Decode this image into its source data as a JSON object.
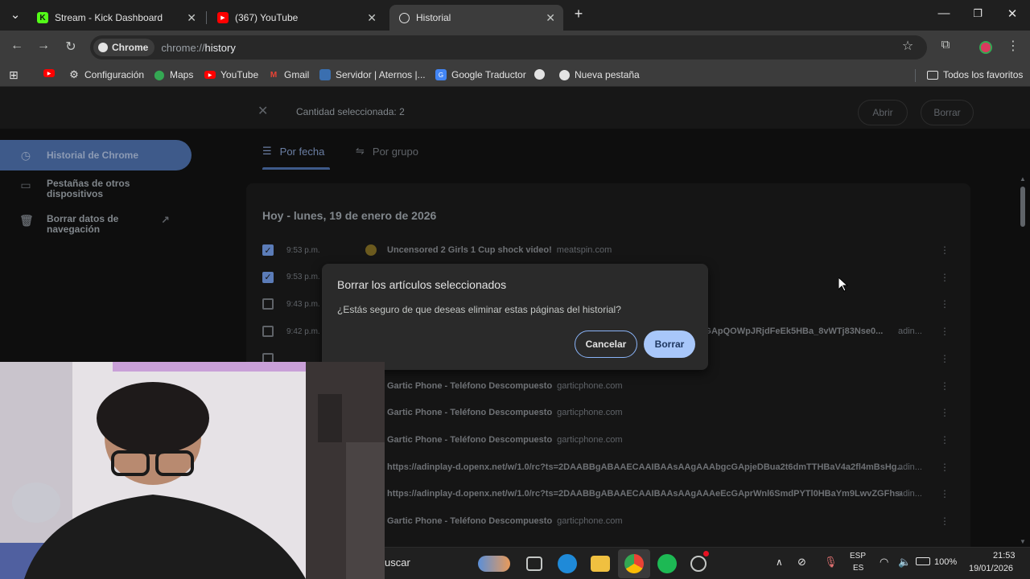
{
  "tabs": [
    {
      "label": "Stream - Kick Dashboard",
      "favicon": "kick-icon",
      "color": "#53fc18"
    },
    {
      "label": "(367) YouTube",
      "favicon": "youtube-icon",
      "color": "#ff0000"
    },
    {
      "label": "Historial",
      "favicon": "history-icon",
      "active": true
    }
  ],
  "toolbar": {
    "chip_label": "Chrome",
    "url_scheme": "chrome://",
    "url_path": "history"
  },
  "bookmarks": [
    {
      "label": "",
      "icon": "youtube-icon"
    },
    {
      "label": "Configuración",
      "icon": "gear-icon"
    },
    {
      "label": "Maps",
      "icon": "maps-icon"
    },
    {
      "label": "YouTube",
      "icon": "youtube-icon"
    },
    {
      "label": "Gmail",
      "icon": "gmail-icon"
    },
    {
      "label": "Servidor | Aternos |...",
      "icon": "aternos-icon"
    },
    {
      "label": "Google Traductor",
      "icon": "translate-icon"
    },
    {
      "label": "",
      "icon": "globe-icon"
    },
    {
      "label": "Nueva pestaña",
      "icon": "globe-icon"
    }
  ],
  "all_bookmarks_label": "Todos los favoritos",
  "selection": {
    "count_label": "Cantidad seleccionada: 2",
    "open_label": "Abrir",
    "delete_label": "Borrar"
  },
  "sidebar": {
    "items": [
      {
        "label": "Historial de Chrome",
        "icon": "history-icon",
        "active": true
      },
      {
        "label": "Pestañas de otros dispositivos",
        "icon": "devices-icon"
      },
      {
        "label": "Borrar datos de navegación",
        "icon": "trash-icon"
      }
    ]
  },
  "history_tabs": [
    {
      "label": "Por fecha",
      "icon": "list-icon",
      "active": true
    },
    {
      "label": "Por grupo",
      "icon": "group-icon"
    }
  ],
  "history": {
    "day_heading": "Hoy - lunes, 19 de enero de 2026",
    "rows": [
      {
        "time": "9:53 p.m.",
        "title": "Uncensored 2 Girls 1 Cup shock video!",
        "domain": "meatspin.com",
        "checked": true,
        "end": ""
      },
      {
        "time": "9:53 p.m.",
        "title": "",
        "domain": "",
        "checked": true,
        "end": ""
      },
      {
        "time": "9:43 p.m.",
        "title": "",
        "domain": "",
        "checked": false,
        "end": ""
      },
      {
        "time": "9:42 p.m.",
        "title": "...ccGApQOWpJRjdFeEk5HBa_8vWTj83Nse0...",
        "domain": "",
        "checked": false,
        "end": "adin..."
      },
      {
        "time": "",
        "title": "",
        "domain": "",
        "checked": false,
        "end": ""
      },
      {
        "time": "",
        "title": "Gartic Phone - Teléfono Descompuesto",
        "domain": "garticphone.com",
        "checked": false,
        "end": ""
      },
      {
        "time": "",
        "title": "Gartic Phone - Teléfono Descompuesto",
        "domain": "garticphone.com",
        "checked": false,
        "end": ""
      },
      {
        "time": "",
        "title": "Gartic Phone - Teléfono Descompuesto",
        "domain": "garticphone.com",
        "checked": false,
        "end": ""
      },
      {
        "time": "",
        "title": "https://adinplay-d.openx.net/w/1.0/rc?ts=2DAABBgABAAECAAIBAAsAAgAAAbgcGApjeDBua2t6dmTTHBaV4a2fl4mBsHg...",
        "domain": "",
        "checked": false,
        "end": "adin..."
      },
      {
        "time": "",
        "title": "https://adinplay-d.openx.net/w/1.0/rc?ts=2DAABBgABAAECAAIBAAsAAgAAAeEcGAprWnl6SmdPYTl0HBaYm9LwvZGFhs4...",
        "domain": "",
        "checked": false,
        "end": "adin..."
      },
      {
        "time": "",
        "title": "Gartic Phone - Teléfono Descompuesto",
        "domain": "garticphone.com",
        "checked": false,
        "end": ""
      }
    ]
  },
  "dialog": {
    "title": "Borrar los artículos seleccionados",
    "body": "¿Estás seguro de que deseas eliminar estas páginas del historial?",
    "cancel_label": "Cancelar",
    "confirm_label": "Borrar"
  },
  "taskbar": {
    "search_text": "uscar",
    "lang_top": "ESP",
    "lang_bottom": "ES",
    "battery": "100%",
    "time": "21:53",
    "date": "19/01/2026"
  },
  "colors": {
    "accent": "#a8c7fa",
    "active_nav": "#3e5a8a"
  }
}
